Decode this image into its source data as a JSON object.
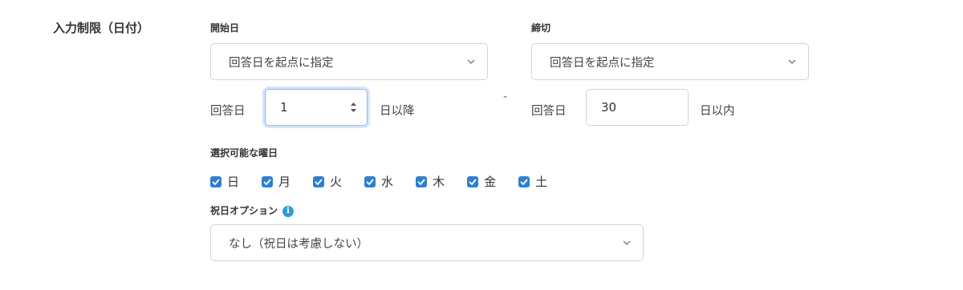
{
  "section": {
    "label": "入力制限（日付）"
  },
  "start": {
    "label": "開始日",
    "mode_select": "回答日を起点に指定",
    "prefix": "回答日",
    "value": "1",
    "suffix": "日以降"
  },
  "separator": "-",
  "end": {
    "label": "締切",
    "mode_select": "回答日を起点に指定",
    "prefix": "回答日",
    "value": "30",
    "suffix": "日以内"
  },
  "weekdays": {
    "label": "選択可能な曜日",
    "items": [
      {
        "label": "日",
        "checked": true
      },
      {
        "label": "月",
        "checked": true
      },
      {
        "label": "火",
        "checked": true
      },
      {
        "label": "水",
        "checked": true
      },
      {
        "label": "木",
        "checked": true
      },
      {
        "label": "金",
        "checked": true
      },
      {
        "label": "土",
        "checked": true
      }
    ]
  },
  "holiday": {
    "label": "祝日オプション",
    "info_icon": "info-icon",
    "select_value": "なし（祝日は考慮しない）"
  },
  "colors": {
    "checkbox": "#2f7fd1",
    "focus_border": "#86b7fe",
    "info": "#2f9bd9"
  }
}
